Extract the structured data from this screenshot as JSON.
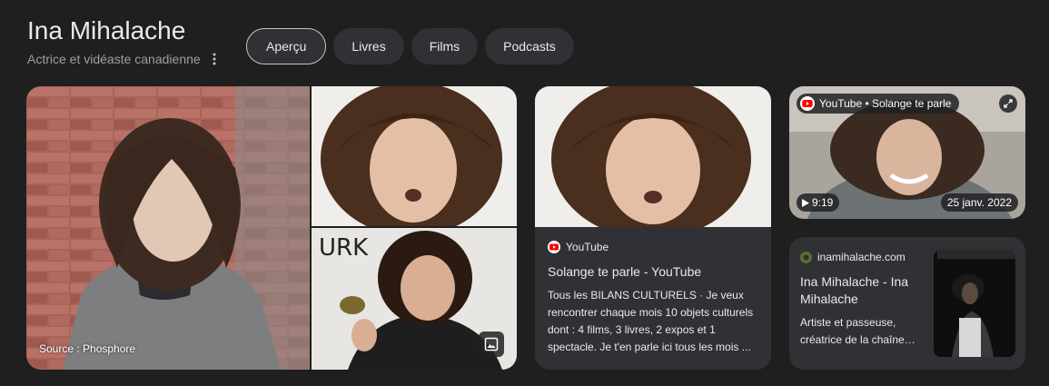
{
  "header": {
    "title": "Ina Mihalache",
    "subtitle": "Actrice et vidéaste canadienne"
  },
  "tabs": [
    "Aperçu",
    "Livres",
    "Films",
    "Podcasts"
  ],
  "photos": {
    "main_source": "Source : Phosphore"
  },
  "youtube_card": {
    "source": "YouTube",
    "title": "Solange te parle - YouTube",
    "snippet": "Tous les BILANS CULTURELS · Je veux rencontrer chaque mois 10 objets culturels dont : 4 films, 3 livres, 2 expos et 1 spectacle. Je t'en parle ici tous les mois ..."
  },
  "video_card": {
    "badge": "YouTube • Solange te parle",
    "duration": "9:19",
    "date": "25 janv. 2022"
  },
  "web_card": {
    "source": "inamihalache.com",
    "title": "Ina Mihalache - Ina Mihalache",
    "snippet": "Artiste et passeuse, créatrice de la chaîne…"
  },
  "colors": {
    "background": "#1f1f1f",
    "card": "#303134",
    "text": "#e8eaed",
    "muted": "#9aa0a6",
    "youtube_red": "#ff0000"
  },
  "icons": [
    "more-vert-icon",
    "youtube-icon",
    "expand-icon",
    "play-icon",
    "image-icon",
    "site-favicon"
  ]
}
